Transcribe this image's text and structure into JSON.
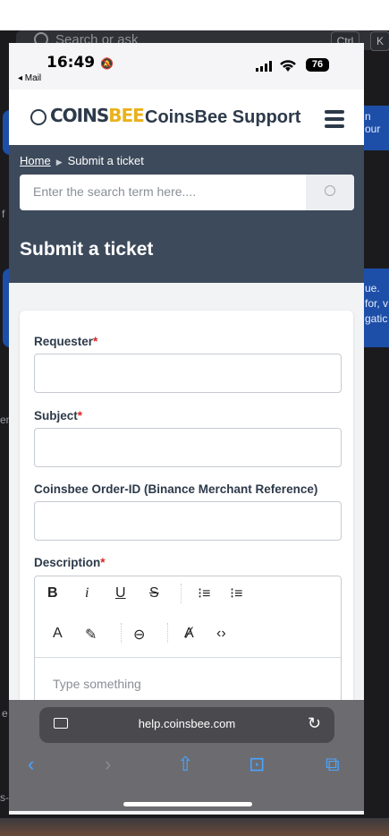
{
  "background": {
    "search_placeholder": "Search or ask",
    "keys": [
      "Ctrl",
      "K"
    ],
    "edge_texts": [
      "n our",
      "f",
      "ue.",
      "for, v",
      "gatic",
      "em",
      "e t",
      "s-"
    ]
  },
  "status_bar": {
    "time": "16:49",
    "back_app": "◂ Mail",
    "battery": "76"
  },
  "header": {
    "logo_part_a": "COINS",
    "logo_part_b": "BEE",
    "title": "CoinsBee Support"
  },
  "breadcrumb": {
    "home": "Home",
    "current": "Submit a ticket"
  },
  "search": {
    "placeholder": "Enter the search term here...."
  },
  "page_title": "Submit a ticket",
  "form": {
    "requester_label": "Requester",
    "subject_label": "Subject",
    "order_id_label": "Coinsbee Order-ID (Binance Merchant Reference)",
    "description_label": "Description",
    "required_mark": "*",
    "editor_placeholder": "Type something",
    "toolbar": {
      "bold": "B",
      "italic": "i",
      "underline": "U",
      "strike": "S"
    }
  },
  "safari": {
    "url": "help.coinsbee.com"
  },
  "colors": {
    "brand_dark": "#2d3a4a",
    "brand_gold": "#e9b21c",
    "hero_bg": "#3d4a5b",
    "required": "#dd2222",
    "safari_blue": "#4aa3ff"
  }
}
